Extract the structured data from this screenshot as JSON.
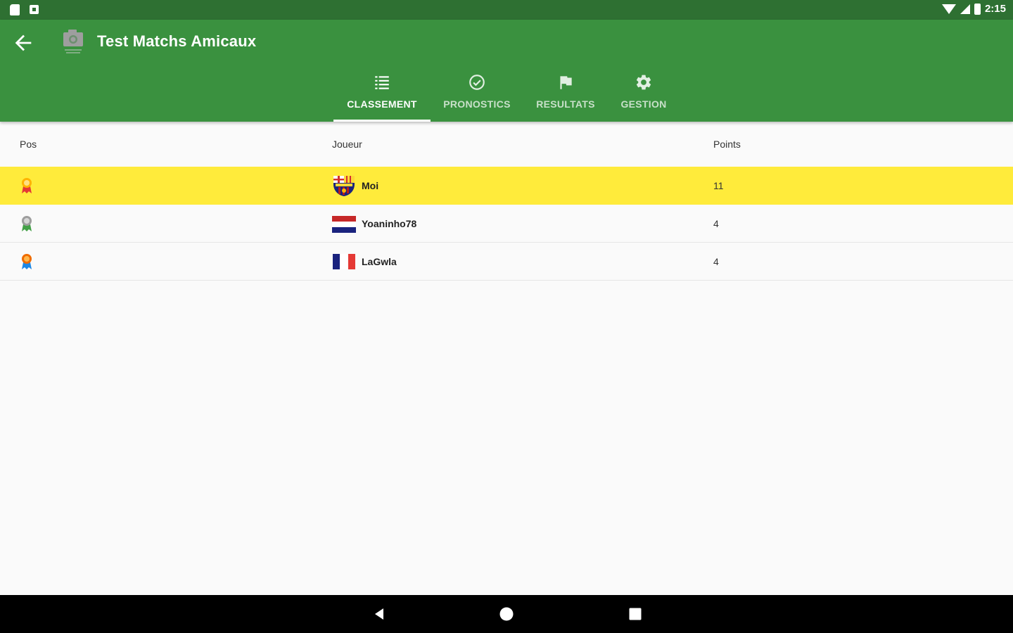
{
  "status_bar": {
    "time": "2:15"
  },
  "app_bar": {
    "title": "Test Matchs Amicaux",
    "back_icon": "arrow-back-icon",
    "avatar_icon": "camera-icon"
  },
  "tabs": [
    {
      "label": "CLASSEMENT",
      "icon": "list-icon",
      "active": true
    },
    {
      "label": "PRONOSTICS",
      "icon": "check-circle-icon",
      "active": false
    },
    {
      "label": "RESULTATS",
      "icon": "flag-icon",
      "active": false
    },
    {
      "label": "GESTION",
      "icon": "gear-icon",
      "active": false
    }
  ],
  "table": {
    "headers": {
      "pos": "Pos",
      "player": "Joueur",
      "points": "Points"
    },
    "rows": [
      {
        "medal": "gold-medal-icon",
        "flag": "fc-barcelona-crest-icon",
        "player": "Moi",
        "points": "11",
        "highlighted": true
      },
      {
        "medal": "silver-medal-icon",
        "flag": "netherlands-flag-icon",
        "player": "Yoaninho78",
        "points": "4",
        "highlighted": false
      },
      {
        "medal": "bronze-medal-icon",
        "flag": "france-flag-icon",
        "player": "LaGwla",
        "points": "4",
        "highlighted": false
      }
    ]
  },
  "nav_bar": {
    "back_icon": "nav-back-icon",
    "home_icon": "nav-home-icon",
    "recents_icon": "nav-recents-icon"
  },
  "colors": {
    "status_bar": "#2e7032",
    "app_bar": "#3a913f",
    "highlight_row": "#ffeb3b",
    "background": "#fafafa"
  }
}
